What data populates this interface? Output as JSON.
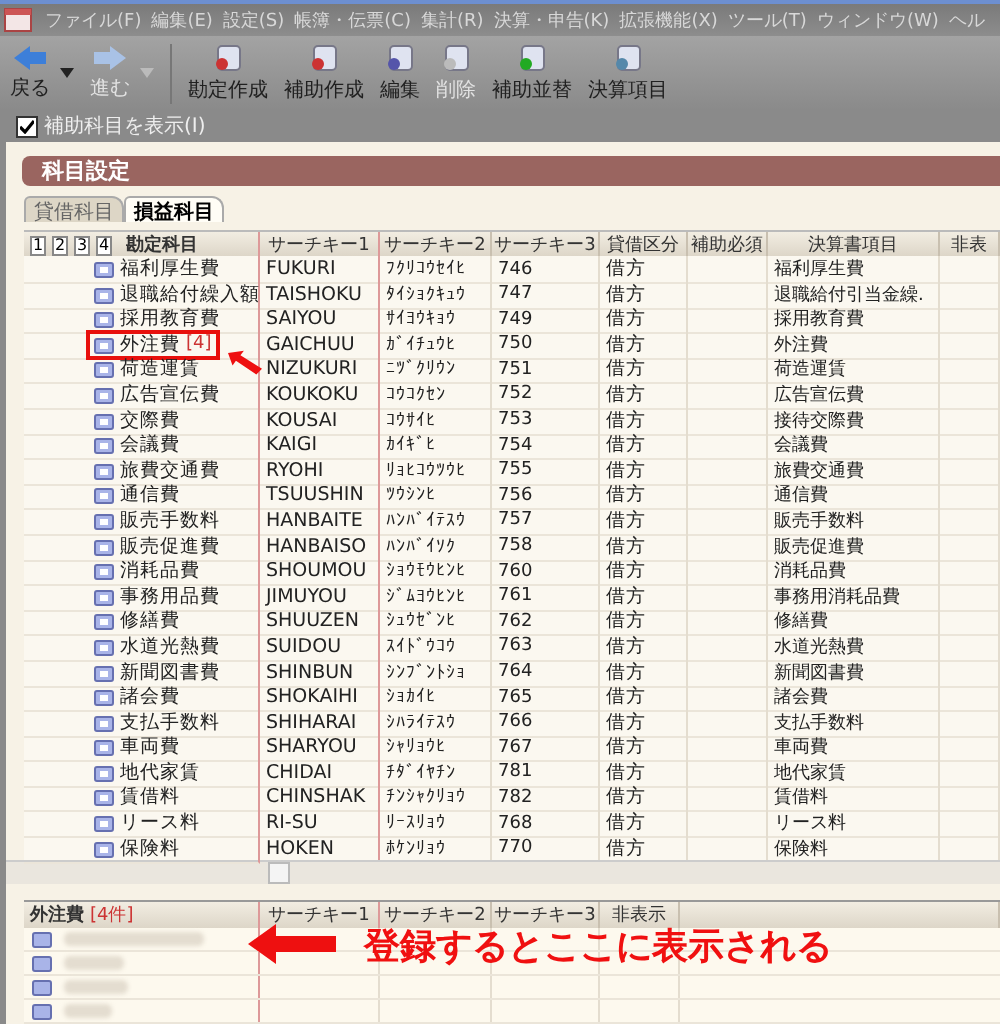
{
  "menu": [
    "ファイル(F)",
    "編集(E)",
    "設定(S)",
    "帳簿・伝票(C)",
    "集計(R)",
    "決算・申告(K)",
    "拡張機能(X)",
    "ツール(T)",
    "ウィンドウ(W)",
    "ヘル"
  ],
  "toolbar": [
    {
      "label": "戻る",
      "kind": "back",
      "disabled": false
    },
    {
      "label": "進む",
      "kind": "forward",
      "disabled": true
    },
    {
      "label": "勘定作成",
      "kind": "tool",
      "disabled": false
    },
    {
      "label": "補助作成",
      "kind": "tool",
      "disabled": false
    },
    {
      "label": "編集",
      "kind": "tool",
      "disabled": false
    },
    {
      "label": "削除",
      "kind": "tool",
      "disabled": true
    },
    {
      "label": "補助並替",
      "kind": "tool",
      "disabled": false
    },
    {
      "label": "決算項目",
      "kind": "tool",
      "disabled": false
    }
  ],
  "show_sub": {
    "label": "補助科目を表示(I)",
    "checked": true
  },
  "panel_title": "科目設定",
  "tabs": [
    {
      "label": "貸借科目",
      "selected": false
    },
    {
      "label": "損益科目",
      "selected": true
    }
  ],
  "levels": [
    "1",
    "2",
    "3",
    "4"
  ],
  "columns": [
    "勘定科目",
    "サーチキー1",
    "サーチキー2",
    "サーチキー3",
    "貸借区分",
    "補助必須",
    "決算書項目",
    "非表"
  ],
  "rows": [
    {
      "name": "福利厚生費",
      "key1": "FUKURI",
      "key2": "ﾌｸﾘｺｳｾｲﾋ",
      "key3": "746",
      "side": "借方",
      "item": "福利厚生費",
      "highlighted": false
    },
    {
      "name": "退職給付繰入額",
      "key1": "TAISHOKU",
      "key2": "ﾀｲｼｮｸｷｭｳ",
      "key3": "747",
      "side": "借方",
      "item": "退職給付引当金繰.",
      "highlighted": false
    },
    {
      "name": "採用教育費",
      "key1": "SAIYOU",
      "key2": "ｻｲﾖｳｷｮｳ",
      "key3": "749",
      "side": "借方",
      "item": "採用教育費",
      "highlighted": false
    },
    {
      "name": "外注費",
      "count": "[4]",
      "key1": "GAICHUU",
      "key2": "ｶﾞｲﾁｭｳﾋ",
      "key3": "750",
      "side": "借方",
      "item": "外注費",
      "highlighted": true
    },
    {
      "name": "荷造運賃",
      "key1": "NIZUKURI",
      "key2": "ﾆﾂﾞｸﾘｳﾝ",
      "key3": "751",
      "side": "借方",
      "item": "荷造運賃",
      "highlighted": false
    },
    {
      "name": "広告宣伝費",
      "key1": "KOUKOKU",
      "key2": "ｺｳｺｸｾﾝ",
      "key3": "752",
      "side": "借方",
      "item": "広告宣伝費",
      "highlighted": false
    },
    {
      "name": "交際費",
      "key1": "KOUSAI",
      "key2": "ｺｳｻｲﾋ",
      "key3": "753",
      "side": "借方",
      "item": "接待交際費",
      "highlighted": false
    },
    {
      "name": "会議費",
      "key1": "KAIGI",
      "key2": "ｶｲｷﾞﾋ",
      "key3": "754",
      "side": "借方",
      "item": "会議費",
      "highlighted": false
    },
    {
      "name": "旅費交通費",
      "key1": "RYOHI",
      "key2": "ﾘｮﾋｺｳﾂｳﾋ",
      "key3": "755",
      "side": "借方",
      "item": "旅費交通費",
      "highlighted": false
    },
    {
      "name": "通信費",
      "key1": "TSUUSHIN",
      "key2": "ﾂｳｼﾝﾋ",
      "key3": "756",
      "side": "借方",
      "item": "通信費",
      "highlighted": false
    },
    {
      "name": "販売手数料",
      "key1": "HANBAITE",
      "key2": "ﾊﾝﾊﾞｲﾃｽｳ",
      "key3": "757",
      "side": "借方",
      "item": "販売手数料",
      "highlighted": false
    },
    {
      "name": "販売促進費",
      "key1": "HANBAISO",
      "key2": "ﾊﾝﾊﾞｲｿｸ",
      "key3": "758",
      "side": "借方",
      "item": "販売促進費",
      "highlighted": false
    },
    {
      "name": "消耗品費",
      "key1": "SHOUMOU",
      "key2": "ｼｮｳﾓｳﾋﾝﾋ",
      "key3": "760",
      "side": "借方",
      "item": "消耗品費",
      "highlighted": false
    },
    {
      "name": "事務用品費",
      "key1": "JIMUYOU",
      "key2": "ｼﾞﾑﾖｳﾋﾝﾋ",
      "key3": "761",
      "side": "借方",
      "item": "事務用消耗品費",
      "highlighted": false
    },
    {
      "name": "修繕費",
      "key1": "SHUUZEN",
      "key2": "ｼｭｳｾﾞﾝﾋ",
      "key3": "762",
      "side": "借方",
      "item": "修繕費",
      "highlighted": false
    },
    {
      "name": "水道光熱費",
      "key1": "SUIDOU",
      "key2": "ｽｲﾄﾞｳｺｳ",
      "key3": "763",
      "side": "借方",
      "item": "水道光熱費",
      "highlighted": false
    },
    {
      "name": "新聞図書費",
      "key1": "SHINBUN",
      "key2": "ｼﾝﾌﾞﾝﾄｼｮ",
      "key3": "764",
      "side": "借方",
      "item": "新聞図書費",
      "highlighted": false
    },
    {
      "name": "諸会費",
      "key1": "SHOKAIHI",
      "key2": "ｼｮｶｲﾋ",
      "key3": "765",
      "side": "借方",
      "item": "諸会費",
      "highlighted": false
    },
    {
      "name": "支払手数料",
      "key1": "SHIHARAI",
      "key2": "ｼﾊﾗｲﾃｽｳ",
      "key3": "766",
      "side": "借方",
      "item": "支払手数料",
      "highlighted": false
    },
    {
      "name": "車両費",
      "key1": "SHARYOU",
      "key2": "ｼｬﾘｮｳﾋ",
      "key3": "767",
      "side": "借方",
      "item": "車両費",
      "highlighted": false
    },
    {
      "name": "地代家賃",
      "key1": "CHIDAI",
      "key2": "ﾁﾀﾞｲﾔﾁﾝ",
      "key3": "781",
      "side": "借方",
      "item": "地代家賃",
      "highlighted": false
    },
    {
      "name": "賃借料",
      "key1": "CHINSHAK",
      "key2": "ﾁﾝｼｬｸﾘｮｳ",
      "key3": "782",
      "side": "借方",
      "item": "賃借料",
      "highlighted": false
    },
    {
      "name": "リース料",
      "key1": "RI-SU",
      "key2": "ﾘｰｽﾘｮｳ",
      "key3": "768",
      "side": "借方",
      "item": "リース料",
      "highlighted": false
    },
    {
      "name": "保険料",
      "key1": "HOKEN",
      "key2": "ﾎｹﾝﾘｮｳ",
      "key3": "770",
      "side": "借方",
      "item": "保険料",
      "highlighted": false
    }
  ],
  "sub": {
    "title": "外注費",
    "count": "[4件]",
    "columns": [
      "サーチキー1",
      "サーチキー2",
      "サーチキー3",
      "非表示"
    ],
    "rows": [
      {
        "blurred": true
      },
      {
        "blurred": true
      },
      {
        "blurred": true
      },
      {
        "blurred": true
      }
    ]
  },
  "annotation": {
    "text": "登録するとここに表示される"
  }
}
